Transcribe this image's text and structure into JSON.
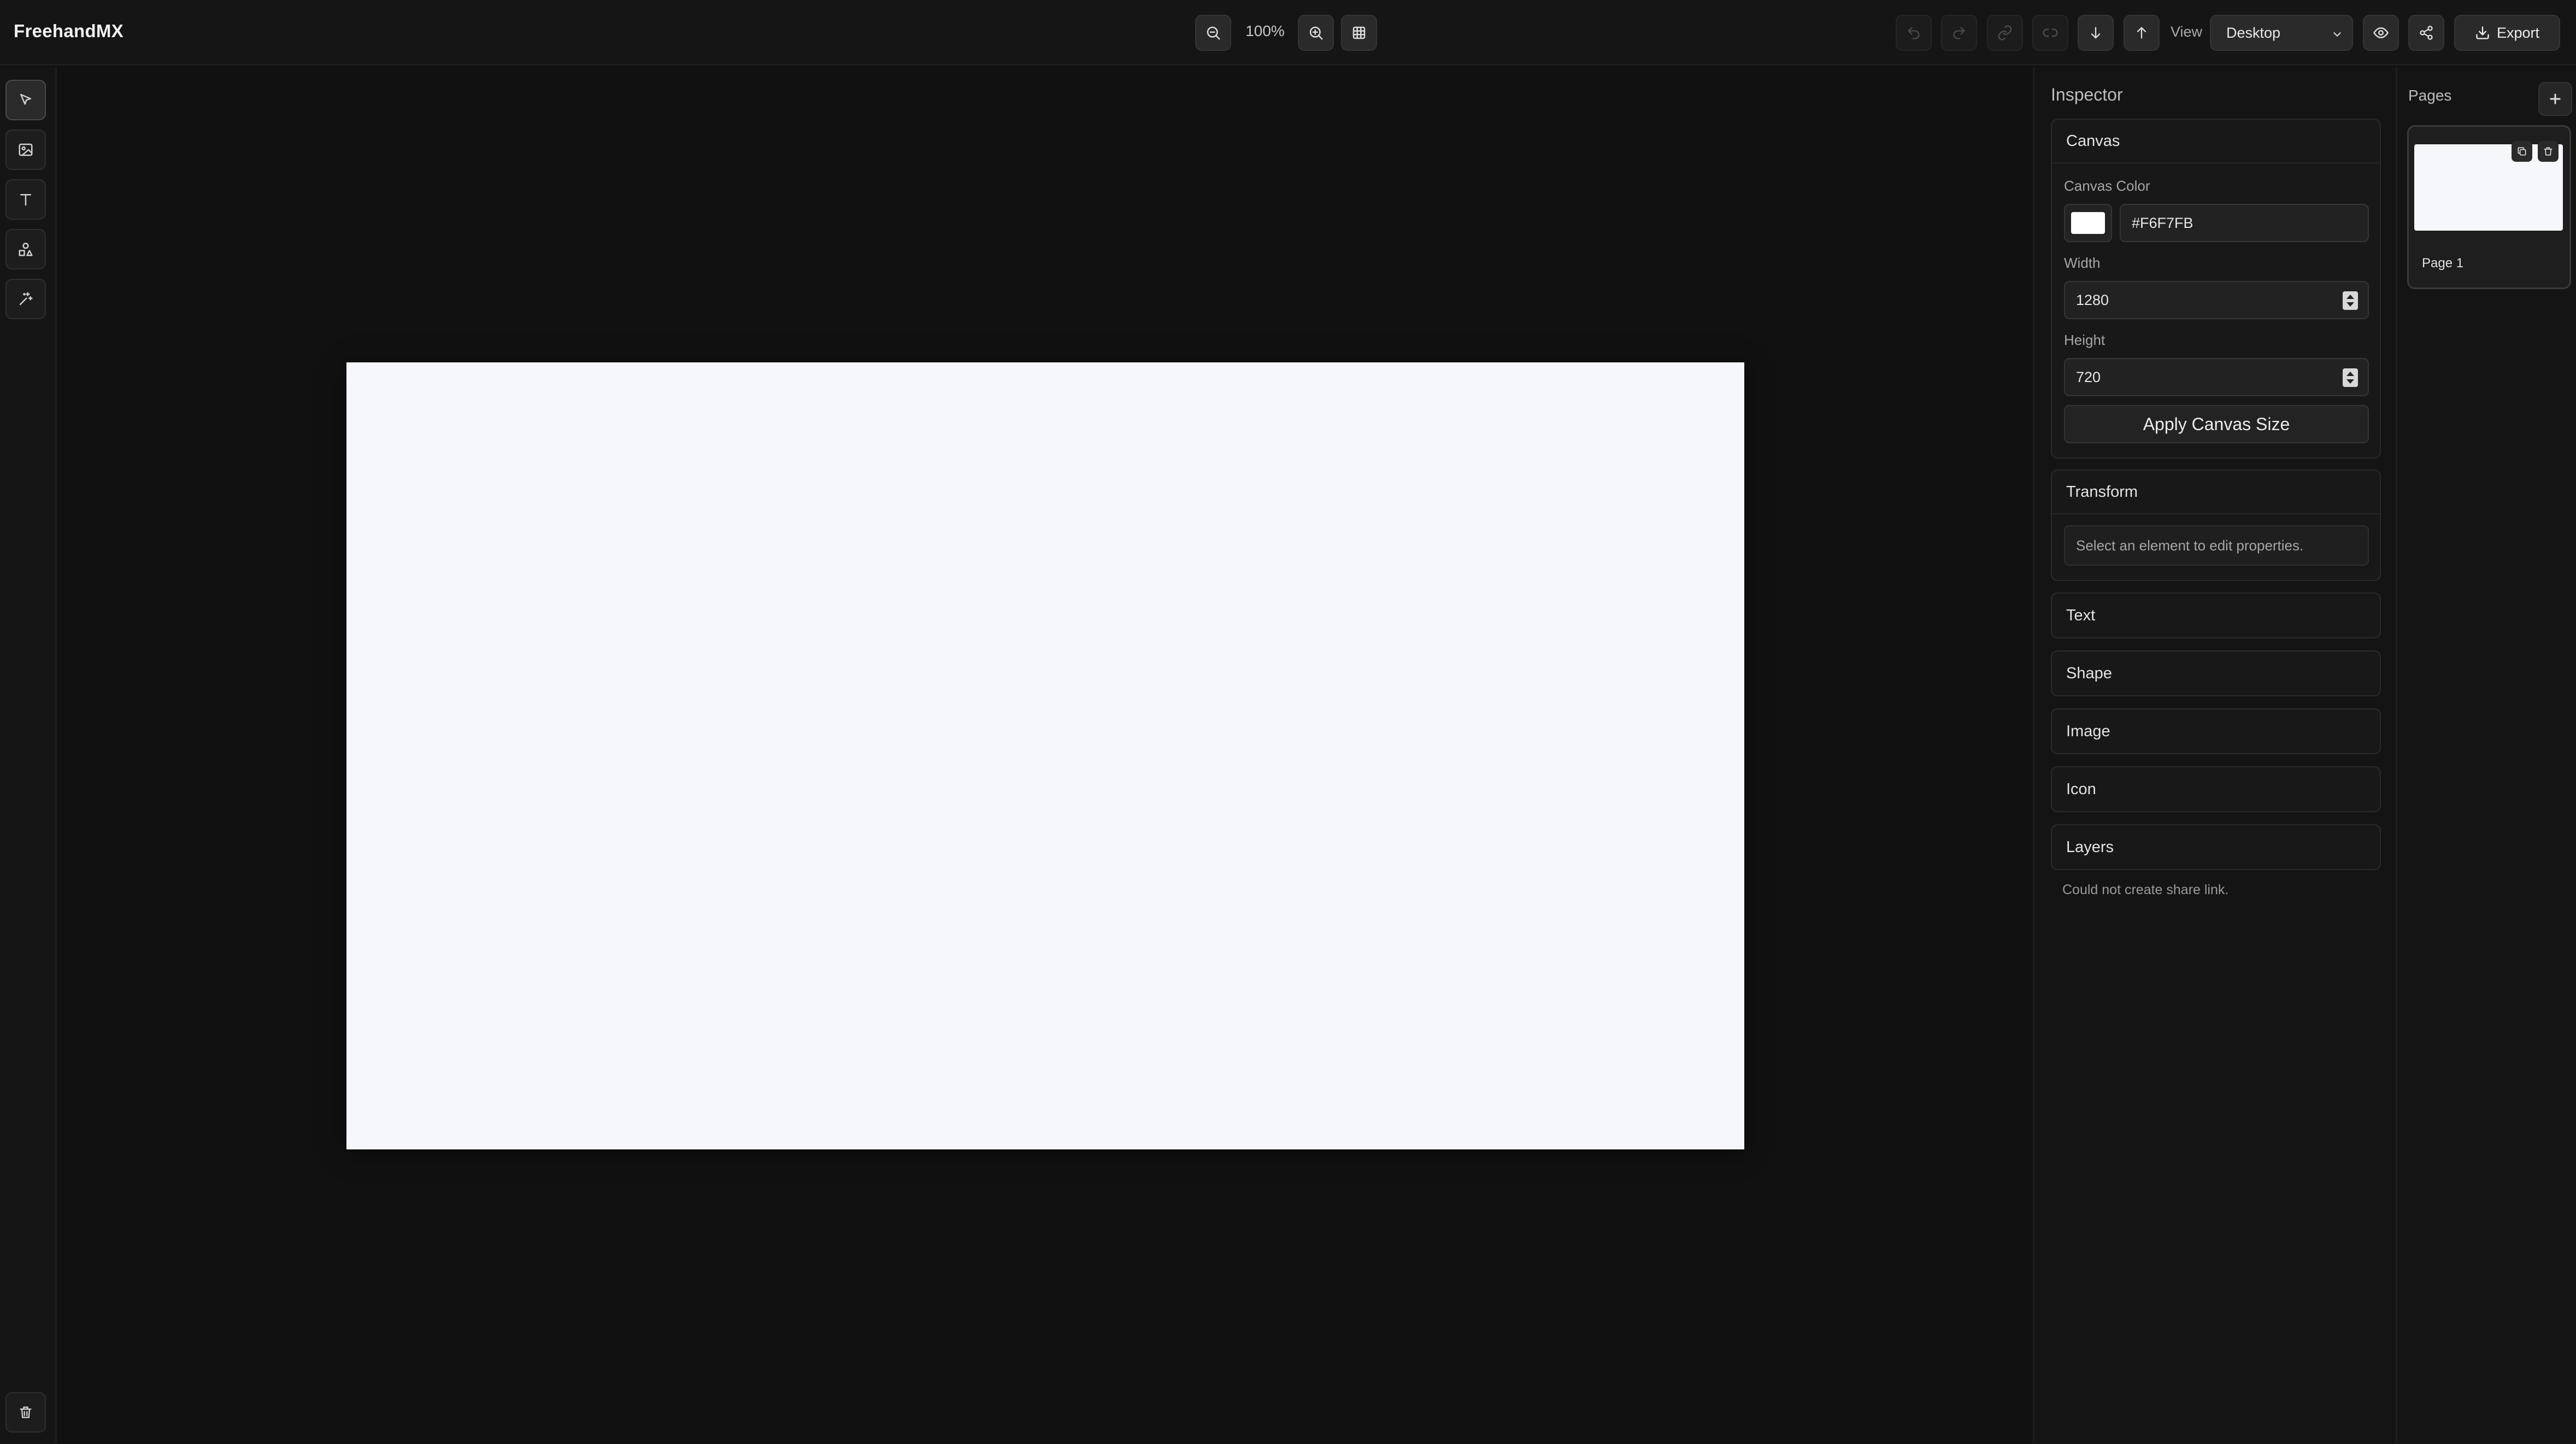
{
  "app": {
    "title": "FreehandMX"
  },
  "toolbar": {
    "zoom_level": "100%",
    "view_label": "View",
    "view_value": "Desktop",
    "export_label": "Export"
  },
  "left_tools": [
    "pointer-icon",
    "image-icon",
    "text-icon",
    "shapes-icon",
    "sparkle-icon"
  ],
  "inspector": {
    "title": "Inspector",
    "canvas": {
      "title": "Canvas",
      "color_label": "Canvas Color",
      "color_value": "#F6F7FB",
      "width_label": "Width",
      "width_value": "1280",
      "height_label": "Height",
      "height_value": "720",
      "apply_label": "Apply Canvas Size"
    },
    "transform": {
      "title": "Transform",
      "hint": "Select an element to edit properties."
    },
    "sections": {
      "text": "Text",
      "shape": "Shape",
      "image": "Image",
      "icon": "Icon",
      "layers": "Layers"
    },
    "status_message": "Could not create share link."
  },
  "pages": {
    "title": "Pages",
    "items": [
      {
        "name": "Page 1"
      }
    ]
  },
  "colors": {
    "background": "#111111",
    "panel": "#141414",
    "canvas": "#F6F7FB"
  }
}
